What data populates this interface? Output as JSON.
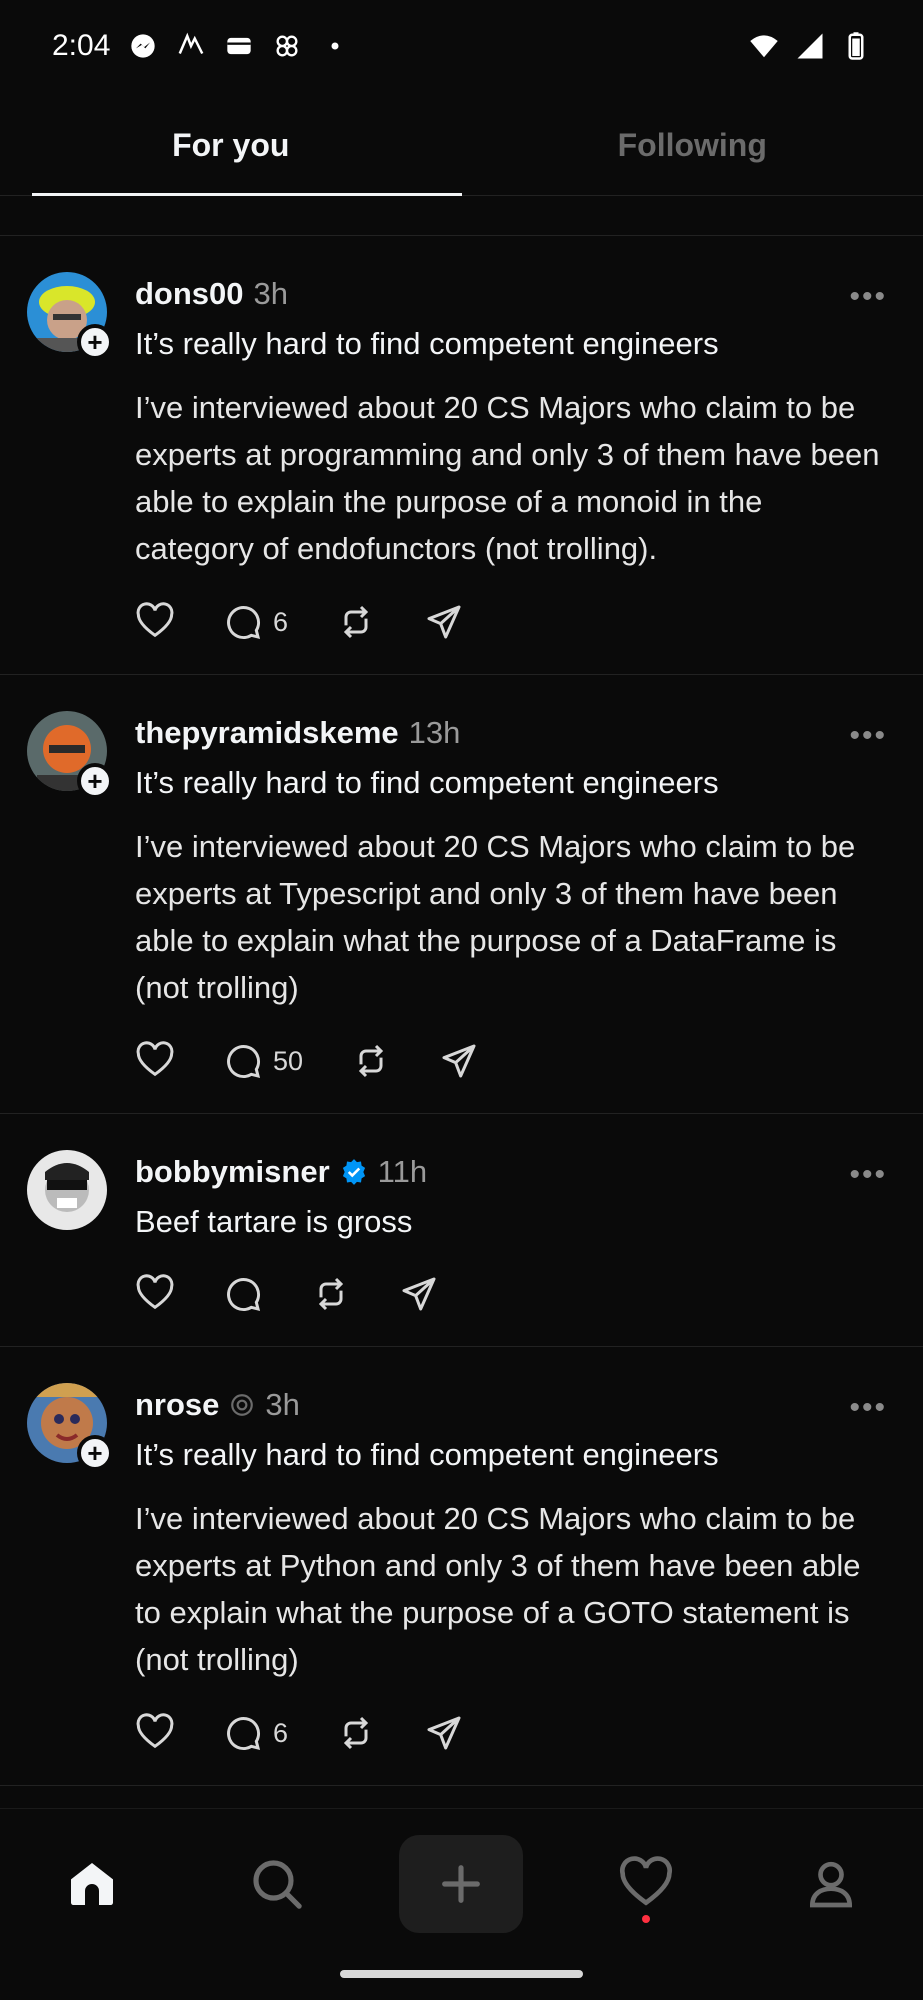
{
  "status_bar": {
    "time": "2:04",
    "icons": [
      "messenger-icon",
      "app-icon",
      "wallet-icon",
      "pinwheel-icon",
      "dot-icon"
    ],
    "right_icons": [
      "wifi-icon",
      "signal-icon",
      "battery-icon"
    ]
  },
  "tabs": [
    {
      "label": "For you",
      "active": true
    },
    {
      "label": "Following",
      "active": false
    }
  ],
  "posts": [
    {
      "username": "dons00",
      "time": "3h",
      "verified": false,
      "title": "It’s really hard to find competent engineers",
      "body": "I’ve interviewed about 20 CS Majors who claim to be experts at programming and only 3 of them have been able to explain the purpose of a monoid in the category of endofunctors (not trolling).",
      "replies": "6"
    },
    {
      "username": "thepyramidskeme",
      "time": "13h",
      "verified": false,
      "title": "It’s really hard to find competent engineers",
      "body": "I’ve interviewed about 20 CS Majors who claim to be experts at Typescript and only 3 of them have been able to explain what the purpose of a DataFrame is (not trolling)",
      "replies": "50"
    },
    {
      "username": "bobbymisner",
      "time": "11h",
      "verified": true,
      "title": "Beef tartare is gross",
      "body": "",
      "replies": ""
    },
    {
      "username": "nrose",
      "time": "3h",
      "verified": false,
      "title": "It’s really hard to find competent engineers",
      "body": "I’ve interviewed about 20 CS Majors who claim to be experts at Python and only 3 of them have been able to explain what the purpose of a GOTO statement is (not trolling)",
      "replies": "6"
    }
  ],
  "bottom_nav": [
    "home-icon",
    "search-icon",
    "create-icon",
    "activity-icon",
    "profile-icon"
  ],
  "colors": {
    "background": "#0a0a0a",
    "verified": "#0095f6",
    "notification_dot": "#ff3040"
  }
}
